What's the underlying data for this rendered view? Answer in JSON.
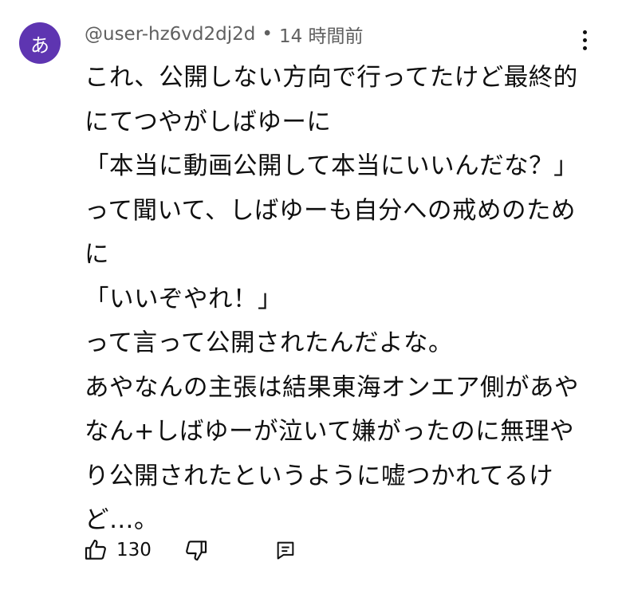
{
  "comment": {
    "avatar_letter": "あ",
    "avatar_color": "#5e35b1",
    "author": "@user-hz6vd2dj2d",
    "separator": "•",
    "time": "14 時間前",
    "lines": [
      "これ、公開しない方向で行ってたけど最終的",
      "にてつやがしばゆーに",
      "「本当に動画公開して本当にいいんだな？」",
      "って聞いて、しばゆーも自分への戒めのため",
      "に",
      "「いいぞやれ！」",
      "って言って公開されたんだよな。",
      "あやなんの主張は結果東海オンエア側があや",
      "なん+しばゆーが泣いて嫌がったのに無理や",
      "り公開されたというように嘘つかれてるけ",
      "ど…。"
    ]
  },
  "actions": {
    "like_icon": "thumb-up-icon",
    "like_count": "130",
    "dislike_icon": "thumb-down-icon",
    "reply_icon": "comment-reply-icon"
  },
  "menu": {
    "icon": "more-vertical-icon"
  }
}
